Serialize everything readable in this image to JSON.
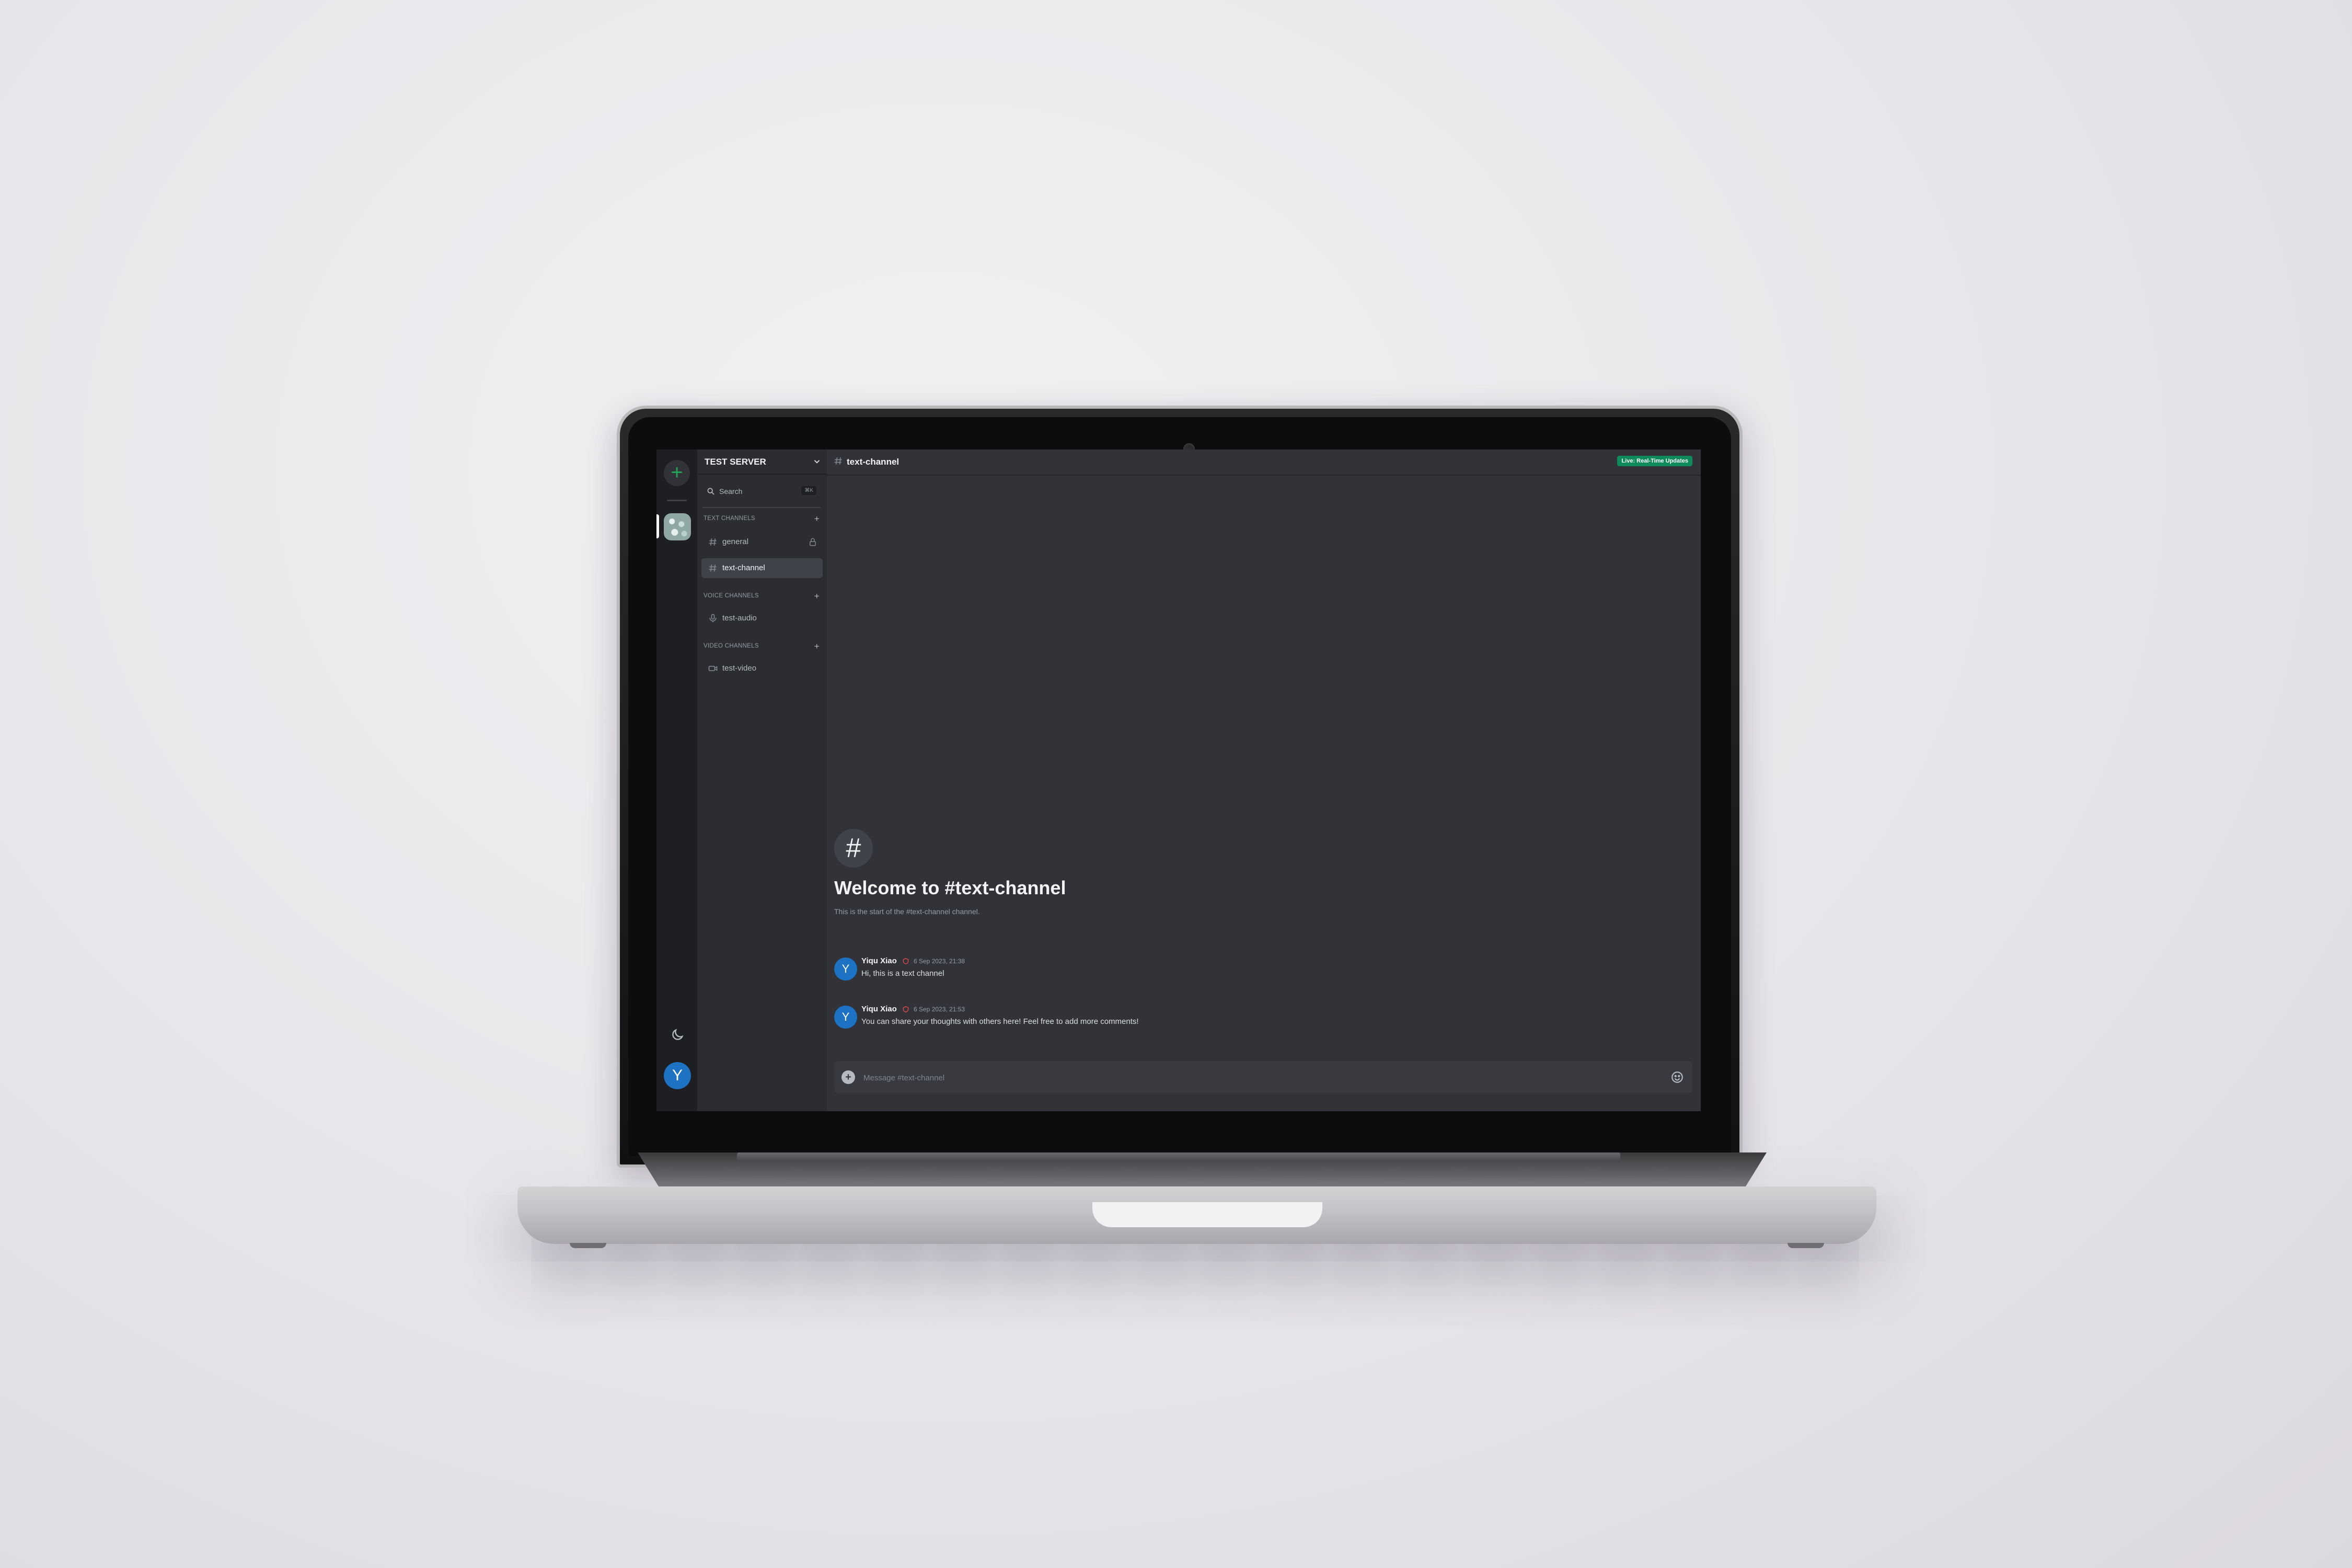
{
  "server": {
    "name": "TEST SERVER"
  },
  "search": {
    "label": "Search",
    "shortcut": "⌘K"
  },
  "categories": {
    "text": "TEXT CHANNELS",
    "voice": "VOICE CHANNELS",
    "video": "VIDEO CHANNELS"
  },
  "channels": {
    "general": "general",
    "text_channel": "text-channel",
    "test_audio": "test-audio",
    "test_video": "test-video"
  },
  "header": {
    "channel": "text-channel",
    "badge": "Live: Real-Time Updates"
  },
  "welcome": {
    "title": "Welcome to #text-channel",
    "subtitle": "This is the start of the #text-channel channel."
  },
  "messages": [
    {
      "avatar": "Y",
      "author": "Yiqu Xiao",
      "timestamp": "6 Sep 2023, 21:38",
      "body": "Hi, this is a text channel"
    },
    {
      "avatar": "Y",
      "author": "Yiqu Xiao",
      "timestamp": "6 Sep 2023, 21:53",
      "body": "You can share your thoughts with others here! Feel free to add more comments!"
    }
  ],
  "composer": {
    "placeholder": "Message #text-channel"
  },
  "user": {
    "avatar": "Y"
  },
  "colors": {
    "accent_green": "#23a559",
    "badge_green": "#0f8a5a",
    "avatar_blue": "#1d72c4",
    "role_red": "#e04848"
  }
}
